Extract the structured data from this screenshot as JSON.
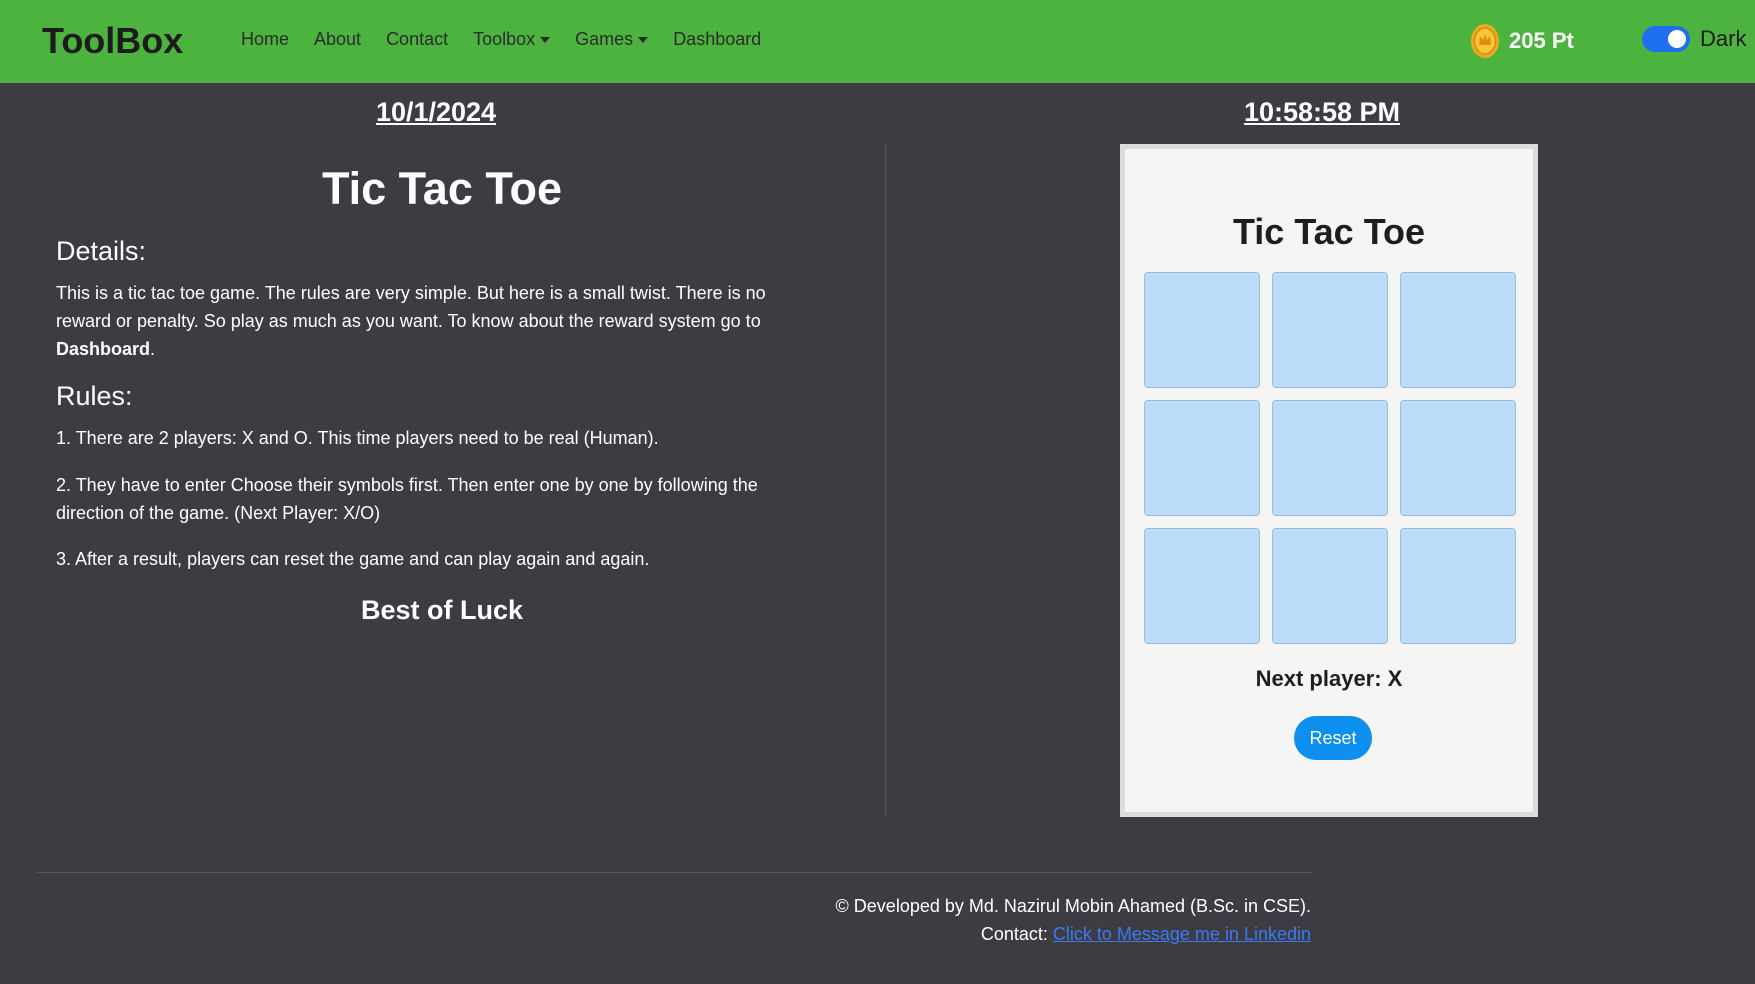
{
  "navbar": {
    "brand": "ToolBox",
    "links": [
      {
        "label": "Home"
      },
      {
        "label": "About"
      },
      {
        "label": "Contact"
      },
      {
        "label": "Toolbox"
      },
      {
        "label": "Games"
      },
      {
        "label": "Dashboard"
      }
    ],
    "points": "205 Pt",
    "theme_label": "Dark"
  },
  "header": {
    "date": "10/1/2024",
    "time": "10:58:58 PM"
  },
  "info": {
    "title": "Tic Tac Toe",
    "details_heading": "Details:",
    "details_text": "This is a tic tac toe game. The rules are very simple. But here is a small twist. There is no reward or penalty. So play as much as you want. To know about the reward system go to ",
    "details_link": "Dashboard",
    "details_end": ".",
    "rules_heading": "Rules:",
    "rules": [
      "1. There are 2 players: X and O. This time players need to be real (Human).",
      "2. They have to enter Choose their symbols first. Then enter one by one by following the direction of the game. (Next Player: X/O)",
      "3. After a result, players can reset the game and can play again and again."
    ],
    "closing": "Best of Luck"
  },
  "game": {
    "title": "Tic Tac Toe",
    "cells": [
      "",
      "",
      "",
      "",
      "",
      "",
      "",
      "",
      ""
    ],
    "status": "Next player: X",
    "reset_label": "Reset"
  },
  "footer": {
    "credit": "© Developed by Md. Nazirul Mobin Ahamed (B.Sc. in CSE).",
    "contact_label": "Contact: ",
    "contact_link": "Click to Message me in Linkedin"
  },
  "colors": {
    "navbar": "#4cb33f",
    "background": "#3c3c42",
    "cell": "#bcdcfa",
    "reset_button": "#0d8ff0",
    "toggle": "#1e6ff2"
  }
}
